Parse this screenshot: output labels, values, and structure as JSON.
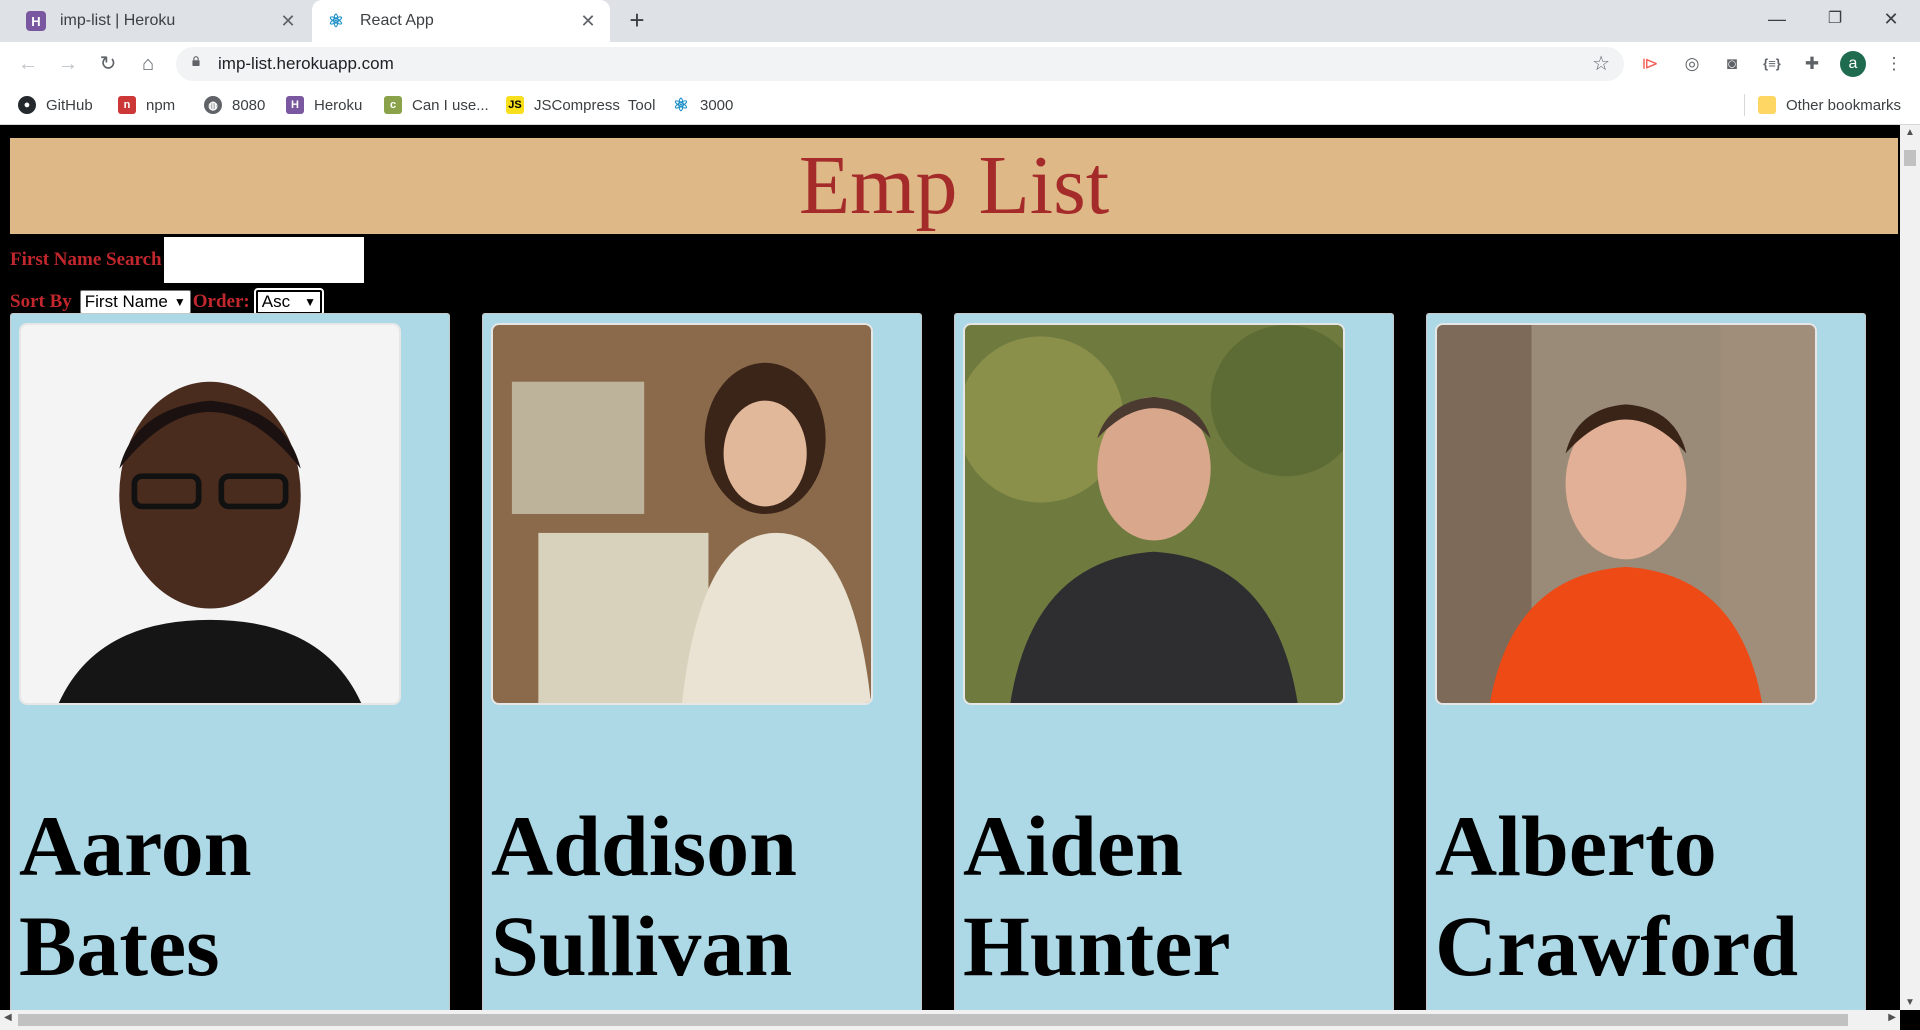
{
  "browser": {
    "tabs": [
      {
        "title": "imp-list | Heroku",
        "icon": "heroku-icon"
      },
      {
        "title": "React App",
        "icon": "react-icon"
      }
    ],
    "url": "imp-list.herokuapp.com",
    "profile_initial": "a",
    "bookmarks": [
      {
        "label": "GitHub",
        "icon": "github-icon"
      },
      {
        "label": "npm",
        "icon": "npm-icon"
      },
      {
        "label": "8080",
        "icon": "globe-icon"
      },
      {
        "label": "Heroku",
        "icon": "heroku-icon"
      },
      {
        "label": "Can I use...",
        "icon": "caniuse-icon"
      },
      {
        "label": "JSCompress  Tool",
        "icon": "js-icon"
      },
      {
        "label": "3000",
        "icon": "react-icon"
      }
    ],
    "other_bookmarks": "Other bookmarks"
  },
  "app": {
    "title": "Emp List",
    "search_label": "First Name Search",
    "search_value": "",
    "sort_label": "Sort By",
    "sort_value": "First Name",
    "order_label": "Order:",
    "order_value": "Asc",
    "employees": [
      {
        "first": "Aaron",
        "last": "Bates"
      },
      {
        "first": "Addison",
        "last": "Sullivan"
      },
      {
        "first": "Aiden",
        "last": "Hunter"
      },
      {
        "first": "Alberto",
        "last": "Crawford"
      }
    ]
  },
  "colors": {
    "header_bg": "#deb887",
    "title_color": "#a52a2a",
    "card_bg": "#add8e6",
    "page_bg": "#000000",
    "label_color": "#c1272d"
  }
}
